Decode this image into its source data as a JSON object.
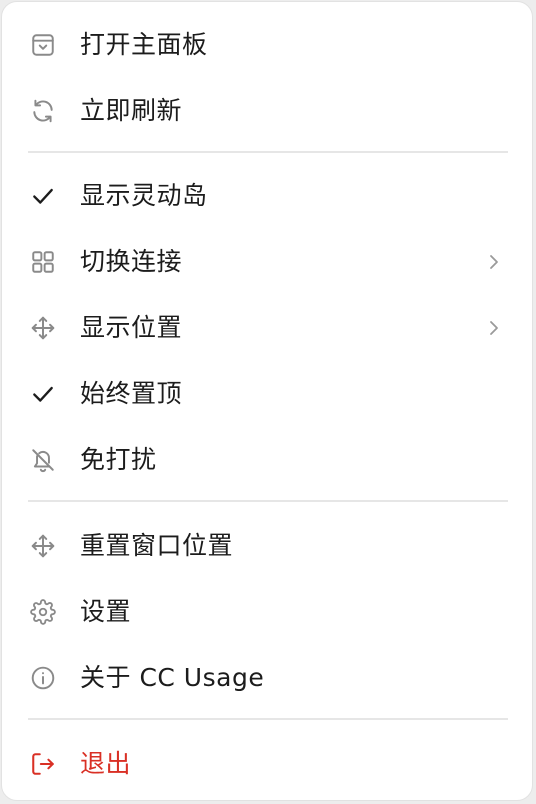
{
  "menu": {
    "items": [
      {
        "label": "打开主面板",
        "icon": "panel-icon"
      },
      {
        "label": "立即刷新",
        "icon": "refresh-icon"
      },
      {
        "label": "显示灵动岛",
        "icon": "check-icon",
        "checked": true
      },
      {
        "label": "切换连接",
        "icon": "grid-icon",
        "submenu": true
      },
      {
        "label": "显示位置",
        "icon": "move-icon",
        "submenu": true
      },
      {
        "label": "始终置顶",
        "icon": "check-icon",
        "checked": true
      },
      {
        "label": "免打扰",
        "icon": "bell-off-icon"
      },
      {
        "label": "重置窗口位置",
        "icon": "move-icon"
      },
      {
        "label": "设置",
        "icon": "gear-icon"
      },
      {
        "label": "关于 CC Usage",
        "icon": "info-icon"
      },
      {
        "label": "退出",
        "icon": "logout-icon"
      }
    ]
  },
  "colors": {
    "text": "#1c1c1c",
    "icon": "#8a8a8a",
    "check": "#1c1c1c",
    "danger": "#d93025",
    "separator": "#e6e6e6"
  }
}
